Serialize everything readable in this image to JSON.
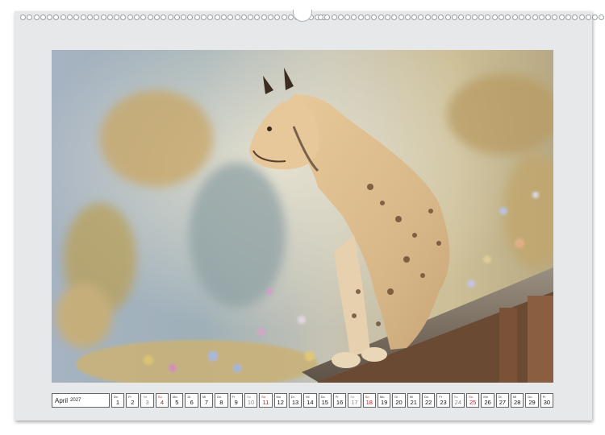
{
  "calendar": {
    "month_label": "April",
    "year_label": "2027",
    "days": [
      {
        "wd": "Do",
        "num": "1",
        "kind": "week"
      },
      {
        "wd": "Fr",
        "num": "2",
        "kind": "week"
      },
      {
        "wd": "Sa",
        "num": "3",
        "kind": "sat"
      },
      {
        "wd": "So",
        "num": "4",
        "kind": "sun"
      },
      {
        "wd": "Mo",
        "num": "5",
        "kind": "week"
      },
      {
        "wd": "Di",
        "num": "6",
        "kind": "week"
      },
      {
        "wd": "Mi",
        "num": "7",
        "kind": "week"
      },
      {
        "wd": "Do",
        "num": "8",
        "kind": "week"
      },
      {
        "wd": "Fr",
        "num": "9",
        "kind": "week"
      },
      {
        "wd": "Sa",
        "num": "10",
        "kind": "sat"
      },
      {
        "wd": "So",
        "num": "11",
        "kind": "sun"
      },
      {
        "wd": "Mo",
        "num": "12",
        "kind": "week"
      },
      {
        "wd": "Di",
        "num": "13",
        "kind": "week"
      },
      {
        "wd": "Mi",
        "num": "14",
        "kind": "week"
      },
      {
        "wd": "Do",
        "num": "15",
        "kind": "week"
      },
      {
        "wd": "Fr",
        "num": "16",
        "kind": "week"
      },
      {
        "wd": "Sa",
        "num": "17",
        "kind": "sat"
      },
      {
        "wd": "So",
        "num": "18",
        "kind": "sun"
      },
      {
        "wd": "Mo",
        "num": "19",
        "kind": "week"
      },
      {
        "wd": "Di",
        "num": "20",
        "kind": "week"
      },
      {
        "wd": "Mi",
        "num": "21",
        "kind": "week"
      },
      {
        "wd": "Do",
        "num": "22",
        "kind": "week"
      },
      {
        "wd": "Fr",
        "num": "23",
        "kind": "week"
      },
      {
        "wd": "Sa",
        "num": "24",
        "kind": "sat"
      },
      {
        "wd": "So",
        "num": "25",
        "kind": "sun"
      },
      {
        "wd": "Mo",
        "num": "26",
        "kind": "week"
      },
      {
        "wd": "Di",
        "num": "27",
        "kind": "week"
      },
      {
        "wd": "Mi",
        "num": "28",
        "kind": "week"
      },
      {
        "wd": "Do",
        "num": "29",
        "kind": "week"
      },
      {
        "wd": "Fr",
        "num": "30",
        "kind": "week"
      }
    ]
  },
  "colors": {
    "sunday": "#c4161c",
    "saturday": "#888888",
    "sheet": "#e6e8ea"
  },
  "illustration": {
    "subject": "lynx-on-wooden-roof"
  }
}
